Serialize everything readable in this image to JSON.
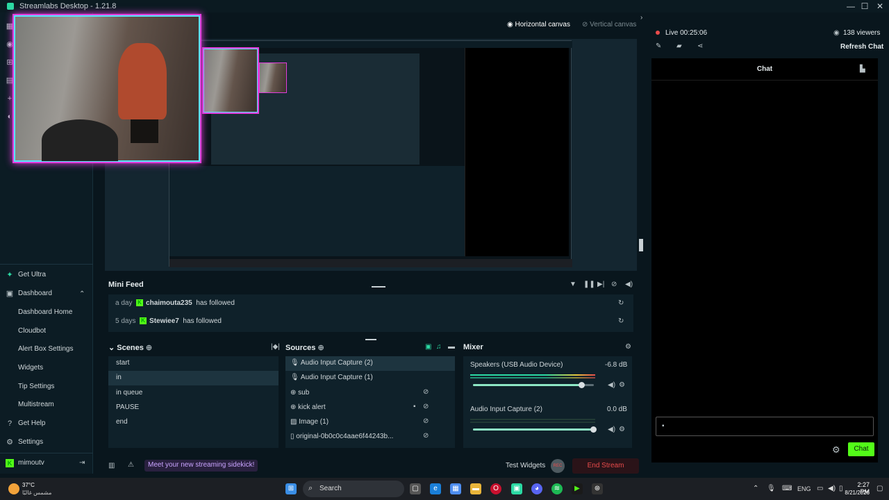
{
  "app": {
    "title": "Streamlabs Desktop - 1.21.8"
  },
  "canvas_tabs": {
    "horizontal": "Horizontal canvas",
    "vertical": "Vertical canvas"
  },
  "live": {
    "status": "Live 00:25:06",
    "viewers": "138 viewers",
    "refresh": "Refresh Chat"
  },
  "nav": {
    "get_ultra": "Get Ultra",
    "dashboard": "Dashboard",
    "items": [
      "Dashboard Home",
      "Cloudbot",
      "Alert Box Settings",
      "Widgets",
      "Tip Settings",
      "Multistream"
    ],
    "get_help": "Get Help",
    "settings": "Settings",
    "user": "mimoutv"
  },
  "minifeed": {
    "title": "Mini Feed",
    "events": [
      {
        "time": "a day",
        "user": "chaimouta235",
        "action": "has followed"
      },
      {
        "time": "5 days",
        "user": "Stewiee7",
        "action": "has followed"
      }
    ]
  },
  "scenes": {
    "title": "Scenes",
    "items": [
      "start",
      "in",
      "in queue",
      "PAUSE",
      "end"
    ],
    "selected": 1
  },
  "sources": {
    "title": "Sources",
    "items": [
      "Audio Input Capture (2)",
      "Audio Input Capture (1)",
      "sub",
      "kick alert",
      "Image (1)",
      "original-0b0c0c4aae6f44243b..."
    ]
  },
  "mixer": {
    "title": "Mixer",
    "channels": [
      {
        "name": "Speakers (USB Audio Device)",
        "db": "-6.8 dB",
        "level": 0.9
      },
      {
        "name": "Audio Input Capture (2)",
        "db": "0.0 dB",
        "level": 1.0
      }
    ]
  },
  "chat": {
    "title": "Chat",
    "send": "Chat"
  },
  "bottom": {
    "promo": "Meet your new streaming sidekick!",
    "test_widgets": "Test Widgets",
    "end_stream": "End Stream",
    "rec": "REC"
  },
  "taskbar": {
    "weather_temp": "37°C",
    "weather_desc": "مشمس غالبًا",
    "search": "Search",
    "lang": "ENG",
    "time": "2:27 PM",
    "date": "8/21/2026"
  },
  "colors": {
    "accent": "#53fc18",
    "end_stream": "#e94b4b",
    "teal": "#2bd9a3"
  }
}
